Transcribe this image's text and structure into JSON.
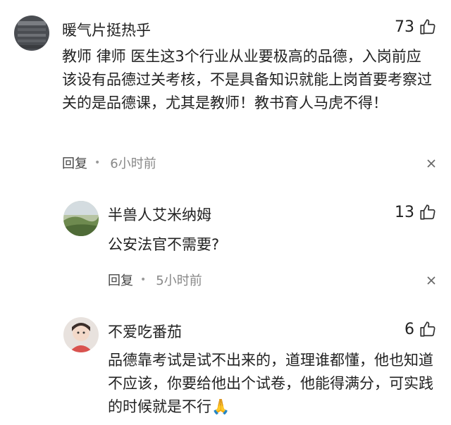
{
  "comments": [
    {
      "username": "暖气片挺热乎",
      "likes": "73",
      "text": "教师 律师 医生这3个行业从业要极高的品德，入岗前应该设有品德过关考核，不是具备知识就能上岗首要考察过关的是品德课，尤其是教师！教书育人马虎不得！",
      "reply_label": "回复",
      "time": "6小时前"
    },
    {
      "username": "半兽人艾米纳姆",
      "likes": "13",
      "text": "公安法官不需要?",
      "reply_label": "回复",
      "time": "5小时前"
    },
    {
      "username": "不爱吃番茄",
      "likes": "6",
      "text": "品德靠考试是试不出来的，道理谁都懂，他也知道不应该，你要给他出个试卷，他能得满分，可实践的时候就是不行🙏",
      "reply_label": null,
      "time": null
    }
  ],
  "icons": {
    "like": "thumbs-up-icon",
    "close": "close-icon",
    "separator": "dot"
  },
  "colors": {
    "text": "#222222",
    "meta_time": "#888888",
    "background": "#ffffff"
  }
}
